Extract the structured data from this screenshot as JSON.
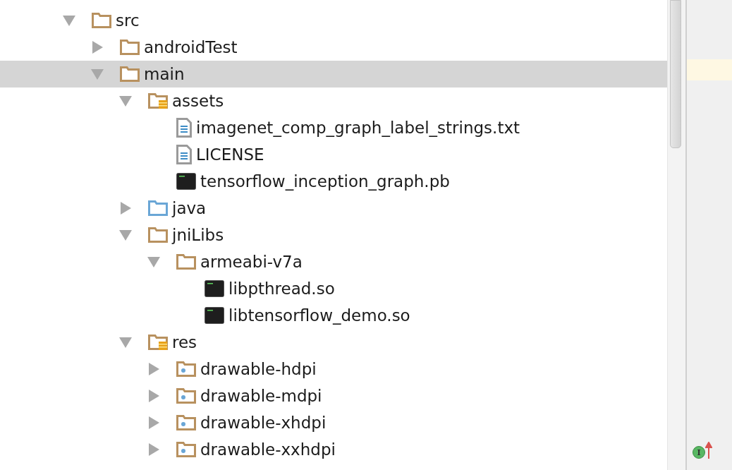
{
  "tree": [
    {
      "label": "src",
      "kind": "folder",
      "expanded": true,
      "selected": false,
      "children": [
        {
          "label": "androidTest",
          "kind": "folder",
          "expanded": false,
          "selected": false
        },
        {
          "label": "main",
          "kind": "folder",
          "expanded": true,
          "selected": true,
          "children": [
            {
              "label": "assets",
              "kind": "resource-folder",
              "expanded": true,
              "selected": false,
              "children": [
                {
                  "label": "imagenet_comp_graph_label_strings.txt",
                  "kind": "text-file",
                  "selected": false
                },
                {
                  "label": "LICENSE",
                  "kind": "text-file",
                  "selected": false
                },
                {
                  "label": "tensorflow_inception_graph.pb",
                  "kind": "binary-file",
                  "selected": false
                }
              ]
            },
            {
              "label": "java",
              "kind": "source-folder",
              "expanded": false,
              "selected": false
            },
            {
              "label": "jniLibs",
              "kind": "folder",
              "expanded": true,
              "selected": false,
              "children": [
                {
                  "label": "armeabi-v7a",
                  "kind": "folder",
                  "expanded": true,
                  "selected": false,
                  "children": [
                    {
                      "label": "libpthread.so",
                      "kind": "binary-file",
                      "selected": false
                    },
                    {
                      "label": "libtensorflow_demo.so",
                      "kind": "binary-file",
                      "selected": false
                    }
                  ]
                }
              ]
            },
            {
              "label": "res",
              "kind": "resource-folder",
              "expanded": true,
              "selected": false,
              "children": [
                {
                  "label": "drawable-hdpi",
                  "kind": "res-folder",
                  "expanded": false,
                  "selected": false
                },
                {
                  "label": "drawable-mdpi",
                  "kind": "res-folder",
                  "expanded": false,
                  "selected": false
                },
                {
                  "label": "drawable-xhdpi",
                  "kind": "res-folder",
                  "expanded": false,
                  "selected": false
                },
                {
                  "label": "drawable-xxhdpi",
                  "kind": "res-folder",
                  "expanded": false,
                  "selected": false
                }
              ]
            }
          ]
        }
      ]
    }
  ],
  "gutter_marker": {
    "letter": "I"
  }
}
